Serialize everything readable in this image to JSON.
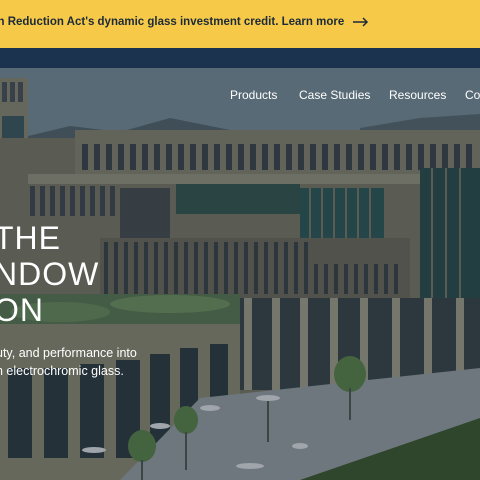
{
  "banner": {
    "text": "dation Reduction Act's dynamic glass investment credit. Learn more"
  },
  "nav": {
    "items": [
      "Products",
      "Case Studies",
      "Resources",
      "Co"
    ]
  },
  "hero": {
    "headline_lines": [
      "THE",
      "NDOW",
      "ON"
    ],
    "subtext_lines": [
      "uty, and performance into",
      "n electrochromic glass."
    ]
  },
  "colors": {
    "banner": "#f7c948",
    "nav_bg": "#1c3350",
    "text": "#ffffff"
  }
}
